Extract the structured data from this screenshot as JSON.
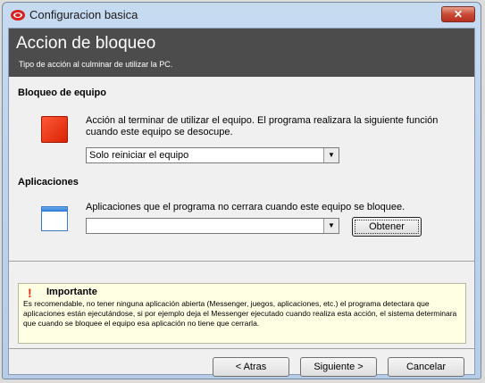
{
  "window": {
    "title": "Configuracion basica",
    "close_label": "✕"
  },
  "header": {
    "title": "Accion de bloqueo",
    "subtitle": "Tipo de acción al culminar de utilizar la PC."
  },
  "bloqueo": {
    "heading": "Bloqueo de equipo",
    "description": "Acción al terminar de utilizar el equipo. El programa realizara la siguiente función cuando este equipo se desocupe.",
    "selected": "Solo reiniciar el equipo"
  },
  "aplicaciones": {
    "heading": "Aplicaciones",
    "description": "Aplicaciones que el programa no cerrara cuando este equipo se bloquee.",
    "selected": "",
    "obtener_label": "Obtener"
  },
  "important": {
    "title": "Importante",
    "text": "Es recomendable, no tener ninguna aplicación abierta (Messenger, juegos, aplicaciones, etc.) el programa detectara que aplicaciones están ejecutándose, si por ejemplo deja el Messenger ejecutado cuando realiza esta acción, el sistema determinara que cuando se bloquee el equipo esa aplicación no tiene que cerrarla."
  },
  "footer": {
    "back_label": "< Atras",
    "next_label": "Siguiente >",
    "cancel_label": "Cancelar"
  }
}
